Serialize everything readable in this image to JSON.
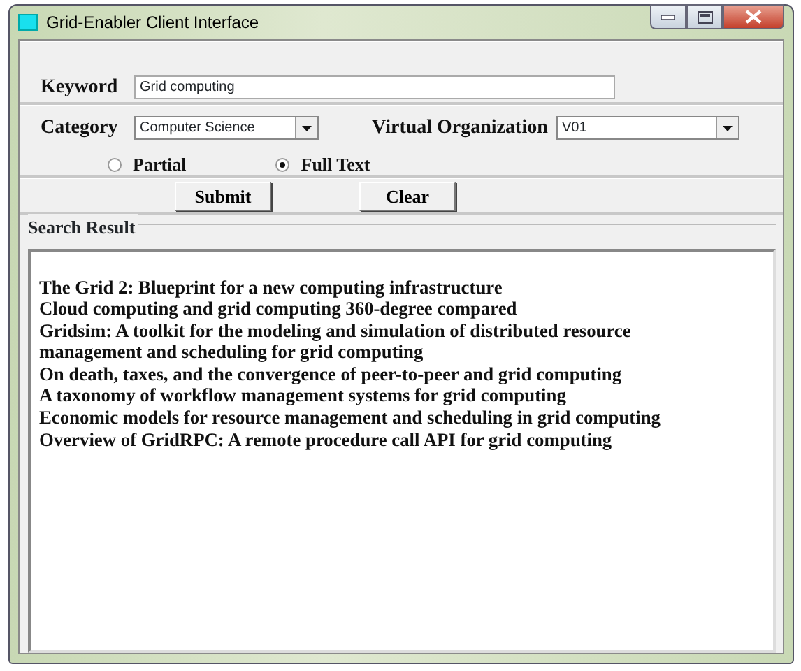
{
  "window": {
    "title": "Grid-Enabler Client Interface"
  },
  "keyword": {
    "label": "Keyword",
    "value": "Grid computing"
  },
  "category": {
    "label": "Category",
    "value": "Computer Science"
  },
  "virtual_organization": {
    "label": "Virtual Organization",
    "value": "V01"
  },
  "match_options": [
    {
      "label": "Partial",
      "selected": false
    },
    {
      "label": "Full Text",
      "selected": true
    }
  ],
  "buttons": [
    "Submit",
    "Clear"
  ],
  "search_result": {
    "title": "Search Result",
    "items": [
      "The Grid 2: Blueprint for a new computing infrastructure",
      "Cloud computing and grid computing 360-degree compared",
      "Gridsim: A toolkit for the modeling and simulation of distributed resource management and scheduling for grid computing",
      "On death, taxes, and the convergence of peer-to-peer and grid computing",
      "A taxonomy of workflow management systems for grid computing",
      "Economic models for resource management and scheduling in grid computing",
      "Overview of GridRPC: A remote procedure call API for grid computing"
    ]
  }
}
